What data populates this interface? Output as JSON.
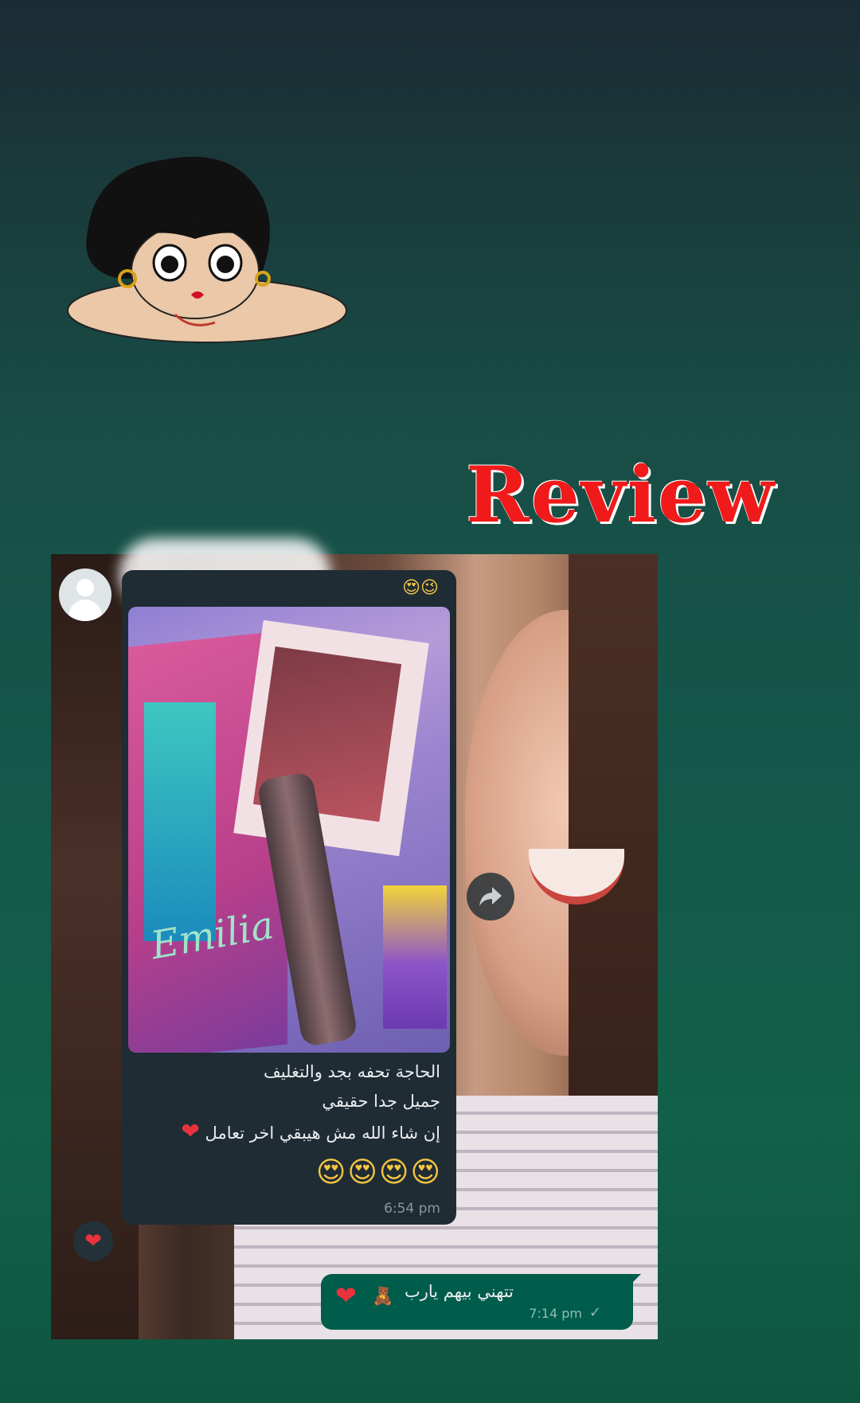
{
  "story_title": "Review",
  "chat": {
    "header_emoji": "😍😉",
    "media_brand_text": "Emilia",
    "incoming_lines": [
      "الحاجة تحفه بجد  والتغليف",
      "جميل جدا حقيقي",
      "إن شاء الله  مش هيبقي اخر تعامل"
    ],
    "incoming_heart": "❤",
    "incoming_emojis": "😍😍😍😍",
    "incoming_time": "6:54 pm",
    "reaction": "❤",
    "outgoing_text": "تتهني بيهم يارب",
    "outgoing_time": "7:14 pm",
    "outgoing_heart": "❤",
    "outgoing_sticker": "🧸",
    "outgoing_check": "✓"
  },
  "colors": {
    "title_red": "#f01a1a",
    "bubble_in": "#1f2c34",
    "bubble_out": "#005c4b"
  }
}
